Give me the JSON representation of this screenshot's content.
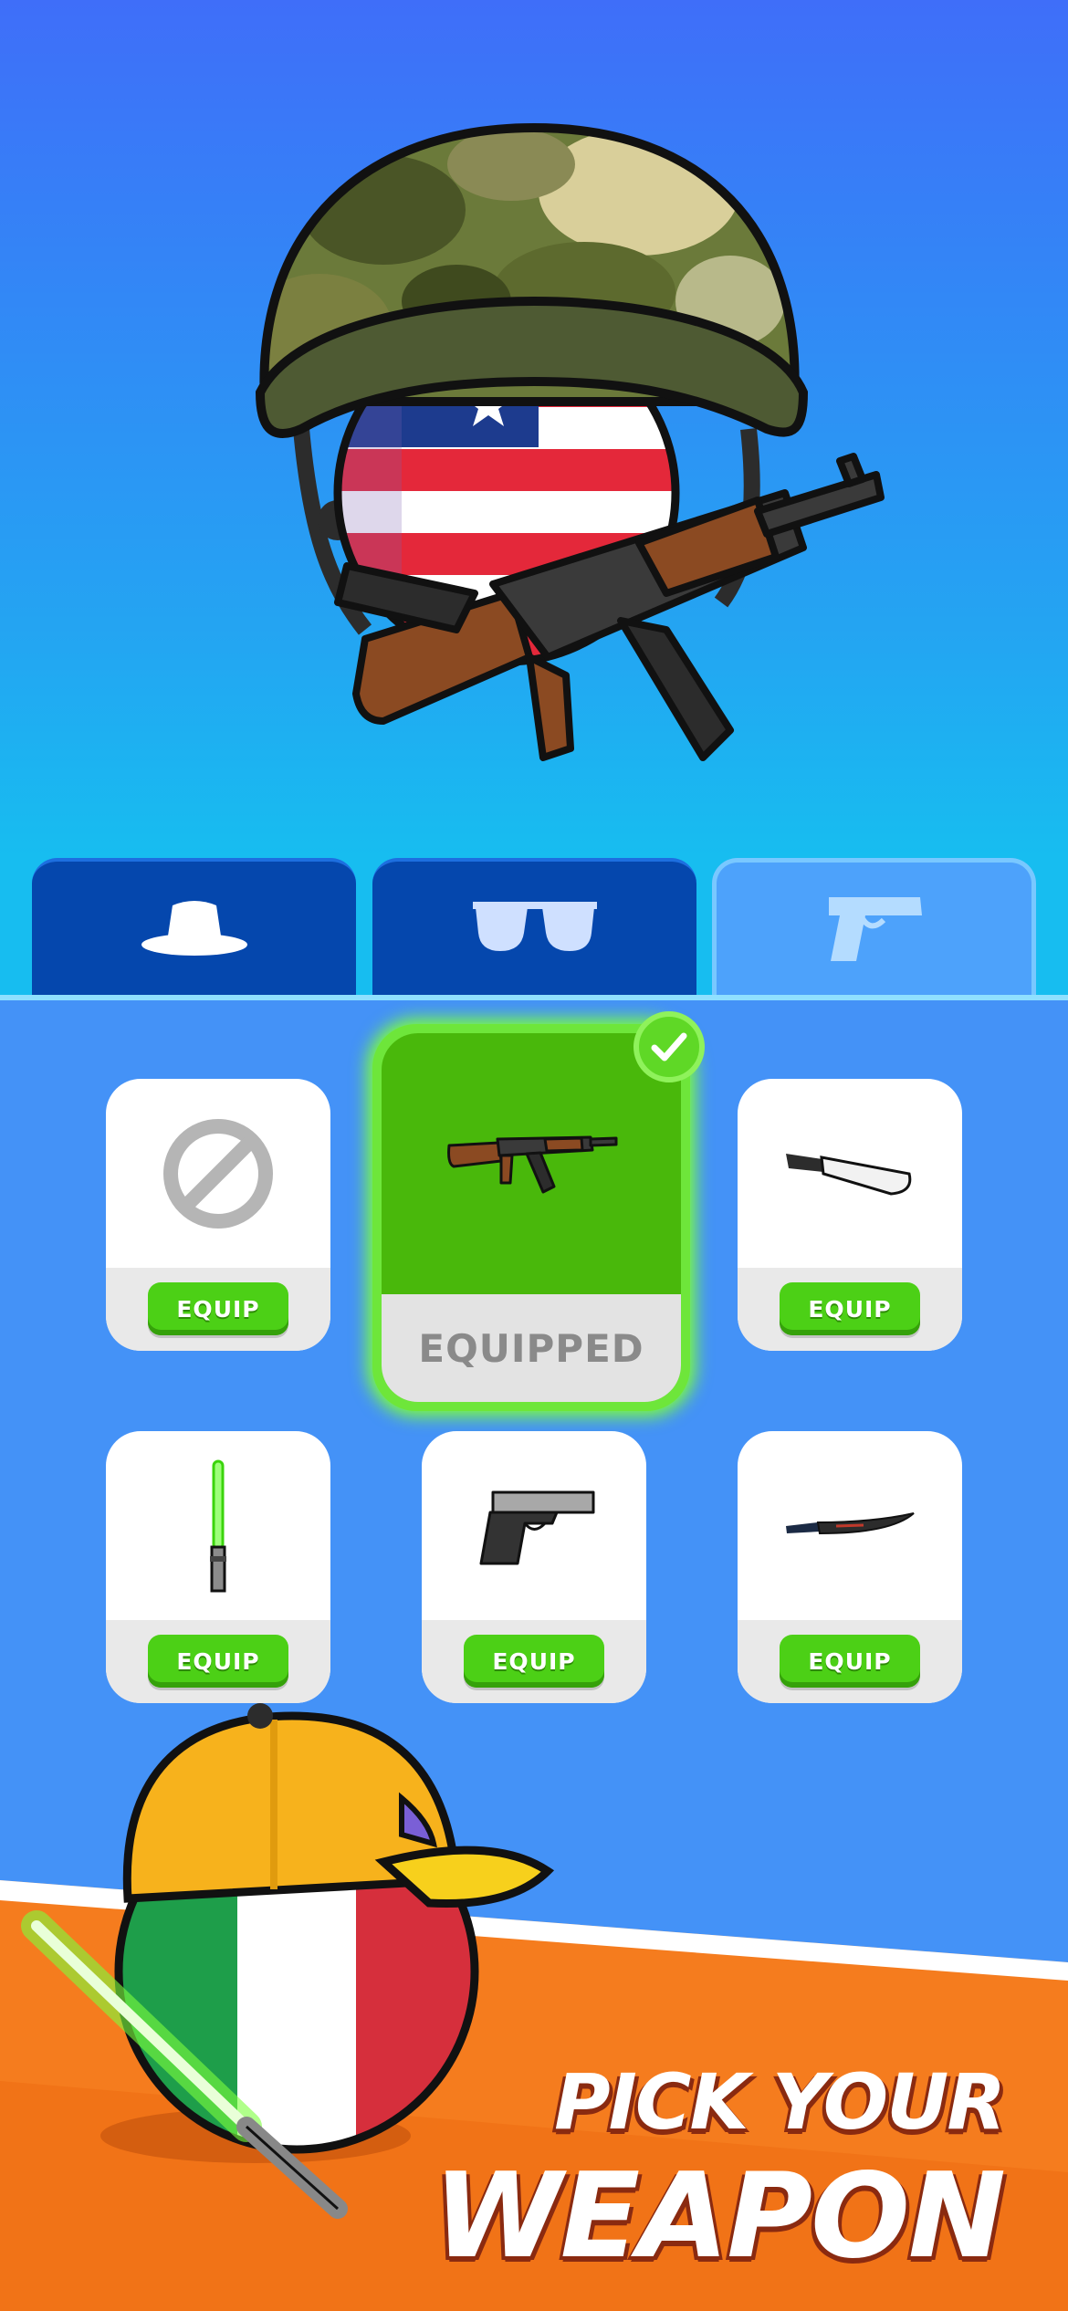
{
  "tabs": [
    {
      "name": "hat-tab",
      "icon": "hat-icon",
      "active": false
    },
    {
      "name": "glasses-tab",
      "icon": "sunglasses-icon",
      "active": false
    },
    {
      "name": "weapon-tab",
      "icon": "pistol-icon",
      "active": true
    }
  ],
  "items": [
    {
      "icon": "none-icon",
      "label": "EQUIP"
    },
    {
      "icon": "ak-rifle-icon",
      "label": "EQUIPPED"
    },
    {
      "icon": "machete-icon",
      "label": "EQUIP"
    },
    {
      "icon": "lightsaber-icon",
      "label": "EQUIP"
    },
    {
      "icon": "pistol-icon",
      "label": "EQUIP"
    },
    {
      "icon": "curved-knife-icon",
      "label": "EQUIP"
    }
  ],
  "promo": {
    "line1": "PICK YOUR",
    "line2": "WEAPON"
  },
  "colors": {
    "equip_green": "#4cd016",
    "panel_blue": "#4492f7",
    "tab_dark": "#0547ad",
    "orange": "#f57c1e"
  }
}
